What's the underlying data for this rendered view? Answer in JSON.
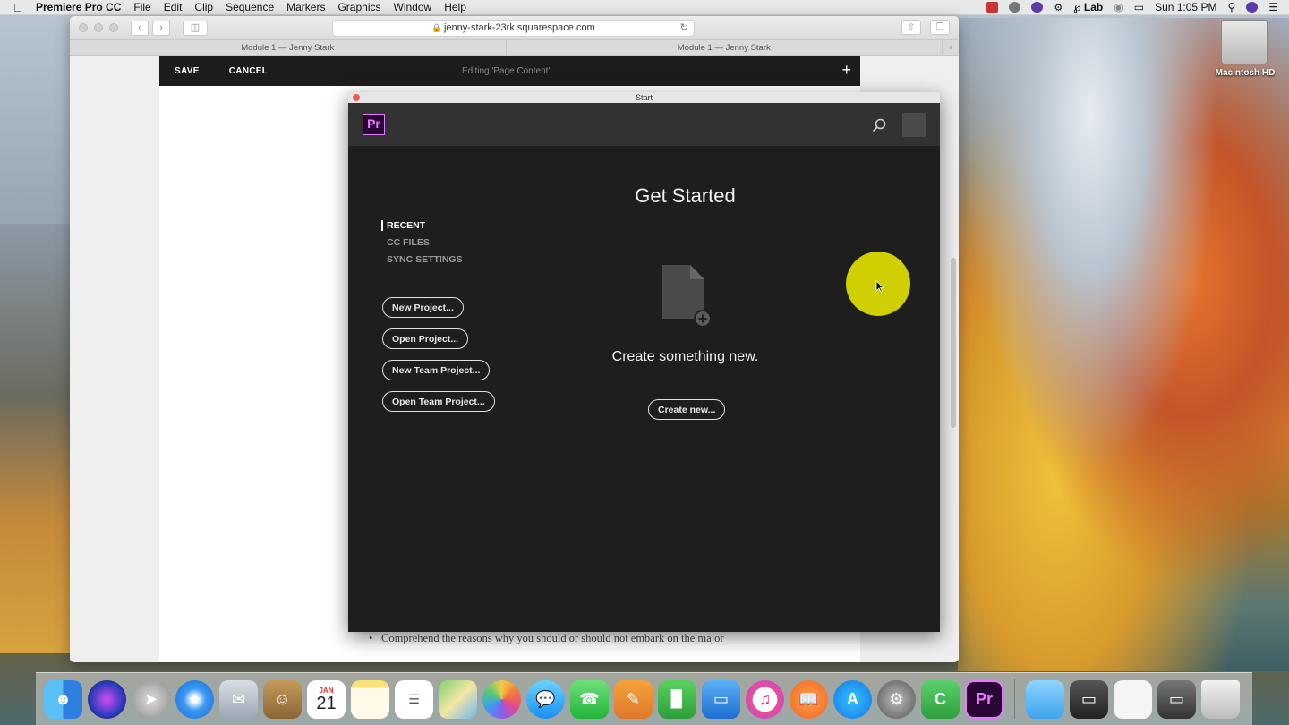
{
  "menubar": {
    "app_name": "Premiere Pro CC",
    "items": [
      "File",
      "Edit",
      "Clip",
      "Sequence",
      "Markers",
      "Graphics",
      "Window",
      "Help"
    ],
    "status_lab": "Lab",
    "clock": "Sun 1:05 PM"
  },
  "desktop": {
    "hd_label": "Macintosh HD"
  },
  "safari": {
    "url": "jenny-stark-23rk.squarespace.com",
    "tabs": [
      "Module 1 — Jenny Stark",
      "Module 1 — Jenny Stark"
    ],
    "editbar": {
      "save": "SAVE",
      "cancel": "CANCEL",
      "editing": "Editing 'Page Content'",
      "add": "+"
    },
    "page_text": "Comprehend the reasons why you should or should not embark on the major"
  },
  "premiere_start": {
    "window_title": "Start",
    "logo_text": "Pr",
    "nav": [
      "RECENT",
      "CC FILES",
      "SYNC SETTINGS"
    ],
    "buttons": [
      "New Project...",
      "Open Project...",
      "New Team Project...",
      "Open Team Project..."
    ],
    "heading": "Get Started",
    "tagline": "Create something new.",
    "create_button": "Create new..."
  },
  "dock": {
    "calendar_month": "JAN",
    "calendar_day": "21"
  },
  "colors": {
    "premiere_accent": "#e77bff",
    "cursor_highlight": "#dede00"
  }
}
